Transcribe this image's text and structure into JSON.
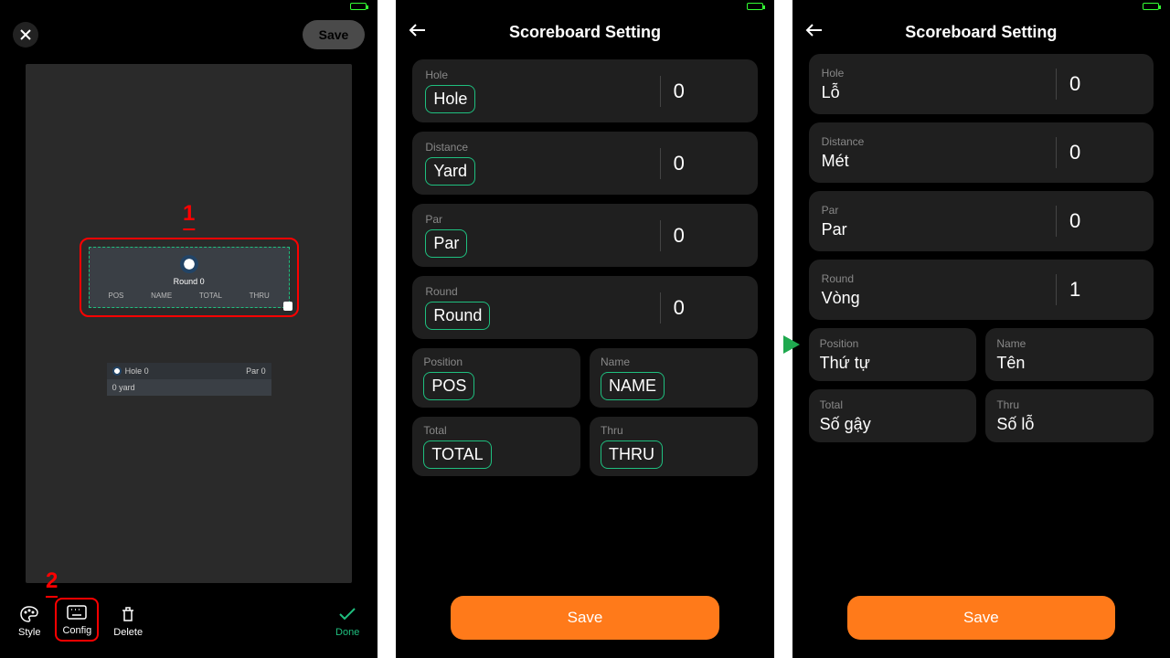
{
  "phone1": {
    "save_label": "Save",
    "callout1": "1",
    "callout2": "2",
    "widget": {
      "round": "Round 0",
      "cols": {
        "pos": "POS",
        "name": "NAME",
        "total": "TOTAL",
        "thru": "THRU"
      }
    },
    "small_widget": {
      "hole": "Hole 0",
      "par": "Par 0",
      "yard": "0 yard"
    },
    "tools": {
      "style": "Style",
      "config": "Config",
      "delete": "Delete",
      "done": "Done"
    }
  },
  "phone2": {
    "title": "Scoreboard Setting",
    "hole": {
      "label": "Hole",
      "value": "Hole",
      "num": "0"
    },
    "distance": {
      "label": "Distance",
      "value": "Yard",
      "num": "0"
    },
    "par": {
      "label": "Par",
      "value": "Par",
      "num": "0"
    },
    "round": {
      "label": "Round",
      "value": "Round",
      "num": "0"
    },
    "position": {
      "label": "Position",
      "value": "POS"
    },
    "name": {
      "label": "Name",
      "value": "NAME"
    },
    "total": {
      "label": "Total",
      "value": "TOTAL"
    },
    "thru": {
      "label": "Thru",
      "value": "THRU"
    },
    "save": "Save"
  },
  "phone3": {
    "title": "Scoreboard Setting",
    "hole": {
      "label": "Hole",
      "value": "Lỗ",
      "num": "0"
    },
    "distance": {
      "label": "Distance",
      "value": "Mét",
      "num": "0"
    },
    "par": {
      "label": "Par",
      "value": "Par",
      "num": "0"
    },
    "round": {
      "label": "Round",
      "value": "Vòng",
      "num": "1"
    },
    "position": {
      "label": "Position",
      "value": "Thứ tự"
    },
    "name": {
      "label": "Name",
      "value": "Tên"
    },
    "total": {
      "label": "Total",
      "value": "Số gậy"
    },
    "thru": {
      "label": "Thru",
      "value": "Số lỗ"
    },
    "save": "Save"
  }
}
